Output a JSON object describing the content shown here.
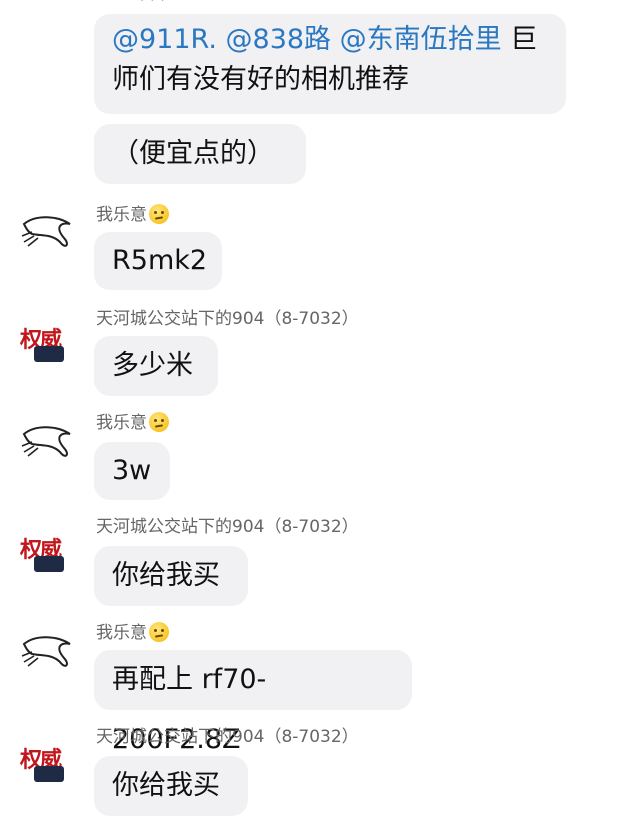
{
  "top_cut_text": "· · ·",
  "users": {
    "u1": "我乐意",
    "u2": "天河城公交站下的904（8-7032）"
  },
  "avatar_text": "权威",
  "messages": [
    {
      "mentions": [
        "@911R.",
        "@838路",
        "@东南伍拾里"
      ],
      "line1_tail": "巨",
      "line2": "师们有没有好的相机推荐"
    },
    {
      "text": "（便宜点的）"
    },
    {
      "text": "R5mk2"
    },
    {
      "text": "多少米"
    },
    {
      "text": "3w"
    },
    {
      "text": "你给我买"
    },
    {
      "text": "再配上 rf70-200F2.8Z"
    },
    {
      "text": "你给我买"
    }
  ]
}
